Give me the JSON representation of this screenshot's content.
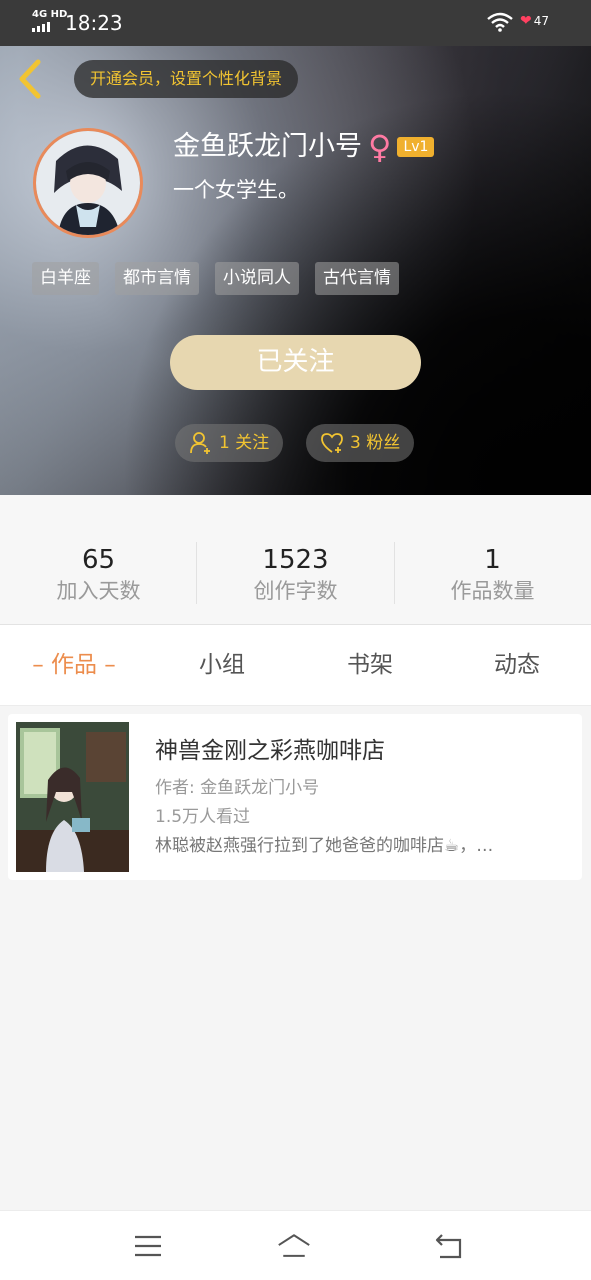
{
  "status_bar": {
    "network": "4G HD",
    "time": "18:23",
    "battery": "47",
    "icons": [
      "signal-icon",
      "wifi-icon",
      "battery-icon"
    ]
  },
  "header": {
    "vip_prompt": "开通会员，设置个性化背景",
    "username": "金鱼跃龙门小号",
    "gender_symbol": "♀",
    "level": "Lv1",
    "bio": "一个女学生。",
    "tags": [
      "白羊座",
      "都市言情",
      "小说同人",
      "古代言情"
    ],
    "follow_button": "已关注",
    "following_label": "1 关注",
    "fans_label": "3 粉丝"
  },
  "stats": [
    {
      "value": "65",
      "label": "加入天数"
    },
    {
      "value": "1523",
      "label": "创作字数"
    },
    {
      "value": "1",
      "label": "作品数量"
    }
  ],
  "tabs": [
    {
      "label": "– 作品 –",
      "active": true
    },
    {
      "label": "小组",
      "active": false
    },
    {
      "label": "书架",
      "active": false
    },
    {
      "label": "动态",
      "active": false
    }
  ],
  "works": [
    {
      "title": "神兽金刚之彩燕咖啡店",
      "author": "作者: 金鱼跃龙门小号",
      "views": "1.5万人看过",
      "description": "林聪被赵燕强行拉到了她爸爸的咖啡店☕，…"
    }
  ],
  "colors": {
    "accent": "#ec8d4d",
    "gold_text": "#f2c431",
    "follow_button_bg": "#e7d7b0",
    "level_badge": "#f0b02e",
    "gender": "#ff7aa3"
  }
}
